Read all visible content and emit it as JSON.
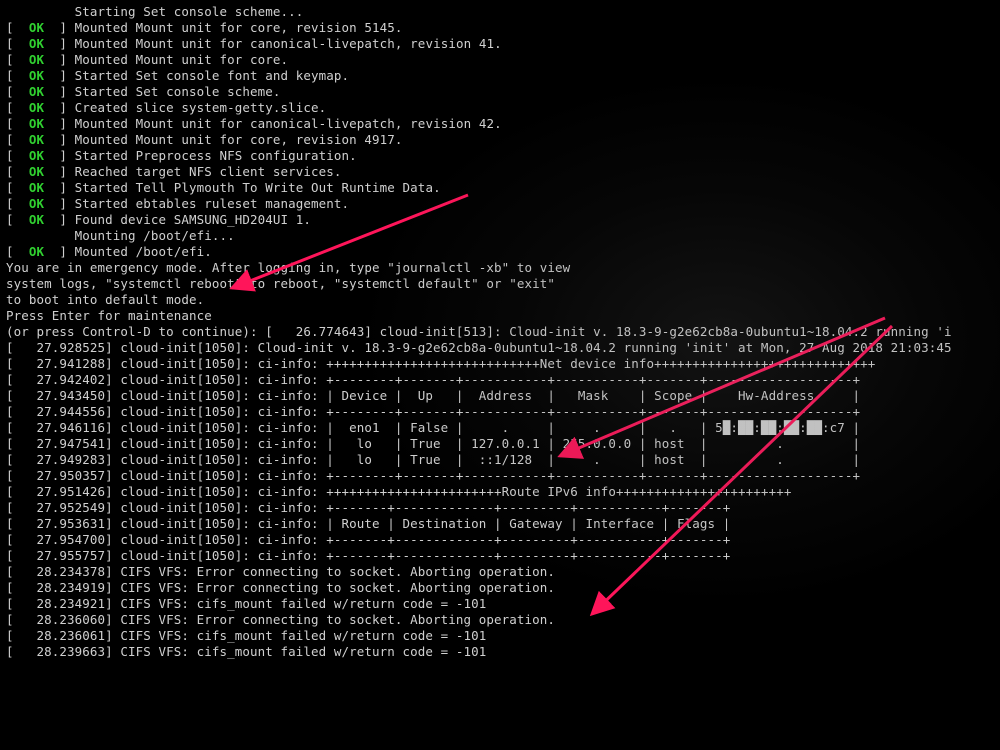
{
  "boot_lines": [
    {
      "status": "",
      "text": "Starting Set console scheme..."
    },
    {
      "status": "OK",
      "text": "Mounted Mount unit for core, revision 5145."
    },
    {
      "status": "OK",
      "text": "Mounted Mount unit for canonical-livepatch, revision 41."
    },
    {
      "status": "OK",
      "text": "Mounted Mount unit for core."
    },
    {
      "status": "OK",
      "text": "Started Set console font and keymap."
    },
    {
      "status": "OK",
      "text": "Started Set console scheme."
    },
    {
      "status": "OK",
      "text": "Created slice system-getty.slice."
    },
    {
      "status": "OK",
      "text": "Mounted Mount unit for canonical-livepatch, revision 42."
    },
    {
      "status": "OK",
      "text": "Mounted Mount unit for core, revision 4917."
    },
    {
      "status": "OK",
      "text": "Started Preprocess NFS configuration."
    },
    {
      "status": "OK",
      "text": "Reached target NFS client services."
    },
    {
      "status": "OK",
      "text": "Started Tell Plymouth To Write Out Runtime Data."
    },
    {
      "status": "OK",
      "text": "Started ebtables ruleset management."
    },
    {
      "status": "OK",
      "text": "Found device SAMSUNG_HD204UI 1."
    },
    {
      "status": "",
      "text": "Mounting /boot/efi..."
    },
    {
      "status": "OK",
      "text": "Mounted /boot/efi."
    }
  ],
  "emergency_msg": [
    "You are in emergency mode. After logging in, type \"journalctl -xb\" to view",
    "system logs, \"systemctl reboot\" to reboot, \"systemctl default\" or \"exit\"",
    "to boot into default mode.",
    "Press Enter for maintenance",
    "(or press Control-D to continue): [   26.774643] cloud-init[513]: Cloud-init v. 18.3-9-g2e62cb8a-0ubuntu1~18.04.2 running 'i"
  ],
  "cloud_init_intro": "[   27.928525] cloud-init[1050]: Cloud-init v. 18.3-9-g2e62cb8a-0ubuntu1~18.04.2 running 'init' at Mon, 27 Aug 2018 21:03:45",
  "ci_timestamps": [
    "27.941288",
    "27.942402",
    "27.943450",
    "27.944556",
    "27.946116",
    "27.947541",
    "27.949283",
    "27.950357",
    "27.951426",
    "27.952549",
    "27.953631",
    "27.954700",
    "27.955757"
  ],
  "ci_prefix": "cloud-init[1050]: ci-info:",
  "net_table": {
    "title": "Net device info",
    "sep": "+--------+-------+-----------+-----------+-------+-------------------+",
    "header": "| Device |  Up   |  Address  |   Mask    | Scope |    Hw-Address     |",
    "rows": [
      "|  eno1  | False |     .     |     .     |   .   | 5█:██:██:██:██:c7 |",
      "|   lo   | True  | 127.0.0.1 | 255.0.0.0 | host  |         .         |",
      "|   lo   | True  |  ::1/128  |     .     | host  |         .         |"
    ]
  },
  "route_table": {
    "title": "Route IPv6 info",
    "sep": "+-------+-------------+---------+-----------+-------+",
    "header": "| Route | Destination | Gateway | Interface | Flags |"
  },
  "cifs_lines": [
    {
      "ts": "28.234378",
      "msg": "CIFS VFS: Error connecting to socket. Aborting operation."
    },
    {
      "ts": "28.234919",
      "msg": "CIFS VFS: Error connecting to socket. Aborting operation."
    },
    {
      "ts": "28.234921",
      "msg": "CIFS VFS: cifs_mount failed w/return code = -101"
    },
    {
      "ts": "28.236060",
      "msg": "CIFS VFS: Error connecting to socket. Aborting operation."
    },
    {
      "ts": "28.236061",
      "msg": "CIFS VFS: cifs_mount failed w/return code = -101"
    },
    {
      "ts": "28.239663",
      "msg": "CIFS VFS: cifs_mount failed w/return code = -101"
    }
  ],
  "arrows": {
    "color": "#ff155a"
  }
}
